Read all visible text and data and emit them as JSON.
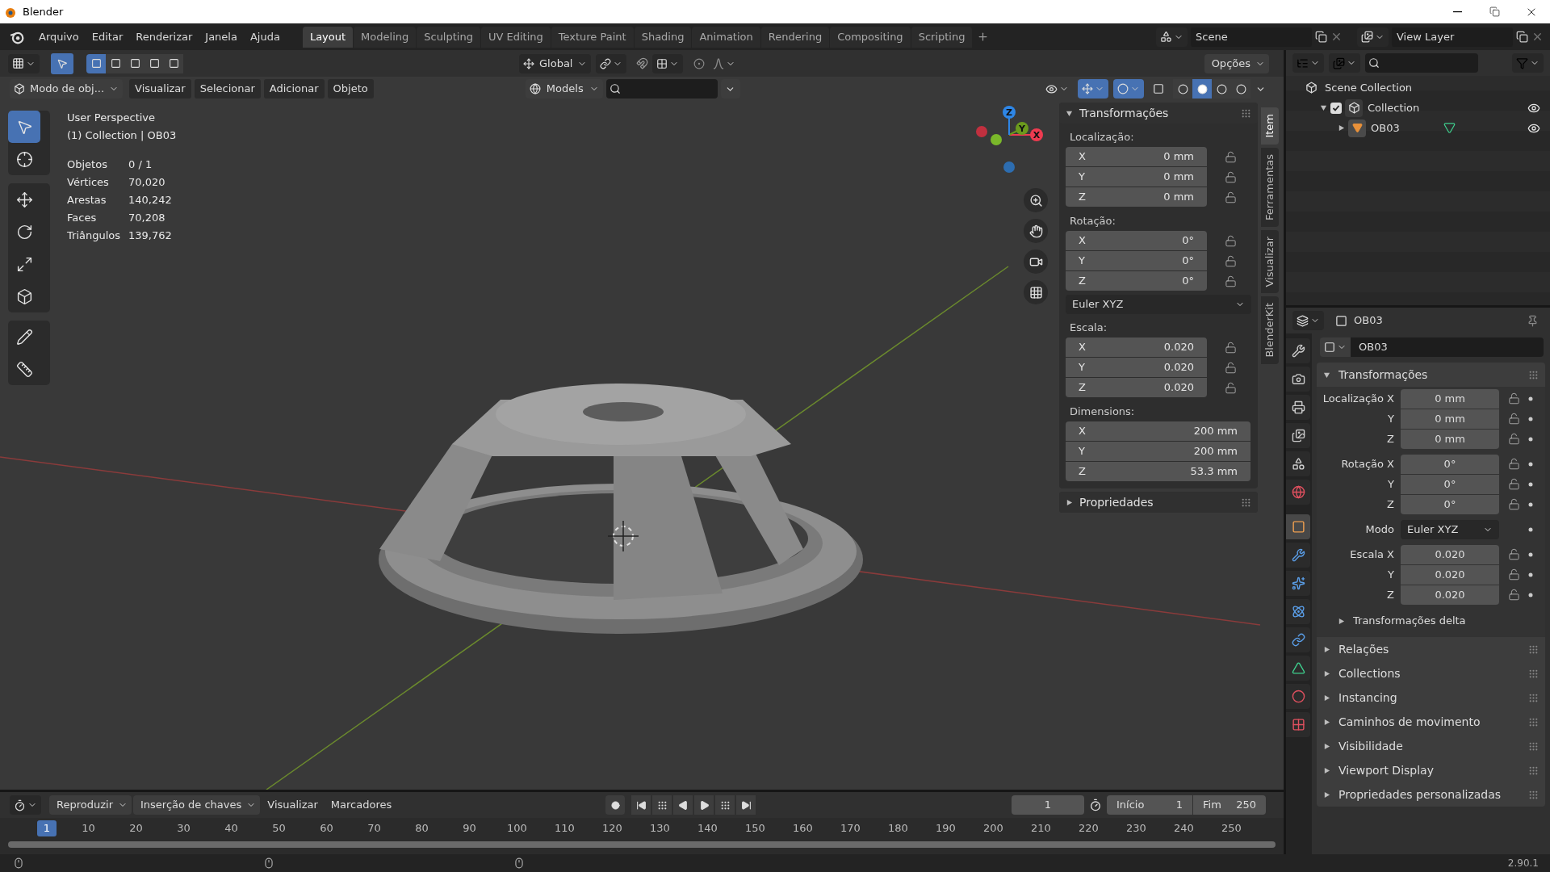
{
  "window": {
    "title": "Blender"
  },
  "menu": [
    "Arquivo",
    "Editar",
    "Renderizar",
    "Janela",
    "Ajuda"
  ],
  "workspaces": [
    {
      "label": "Layout",
      "selected": true
    },
    {
      "label": "Modeling",
      "selected": false
    },
    {
      "label": "Sculpting",
      "selected": false
    },
    {
      "label": "UV Editing",
      "selected": false
    },
    {
      "label": "Texture Paint",
      "selected": false
    },
    {
      "label": "Shading",
      "selected": false
    },
    {
      "label": "Animation",
      "selected": false
    },
    {
      "label": "Rendering",
      "selected": false
    },
    {
      "label": "Compositing",
      "selected": false
    },
    {
      "label": "Scripting",
      "selected": false
    }
  ],
  "scene": "Scene",
  "view_layer": "View Layer",
  "viewport": {
    "header": {
      "orientation": "Global",
      "options": "Opções",
      "mode": "Modo de obj...",
      "menus": [
        "Visualizar",
        "Selecionar",
        "Adicionar",
        "Objeto"
      ],
      "collection": "Models"
    },
    "tools": [
      {
        "kind": "select",
        "selected": true
      },
      {
        "kind": "cursor",
        "selected": false
      },
      {
        "kind": "move",
        "selected": false
      },
      {
        "kind": "rotate",
        "selected": false
      },
      {
        "kind": "scale",
        "selected": false
      },
      {
        "kind": "transform",
        "selected": false
      },
      {
        "kind": "annotate",
        "selected": false
      },
      {
        "kind": "measure",
        "selected": false
      }
    ],
    "view": "User Perspective",
    "context": "(1) Collection | OB03",
    "stats": [
      {
        "label": "Objetos",
        "value": "0 / 1"
      },
      {
        "label": "Vértices",
        "value": "70,020"
      },
      {
        "label": "Arestas",
        "value": "140,242"
      },
      {
        "label": "Faces",
        "value": "70,208"
      },
      {
        "label": "Triângulos",
        "value": "139,762"
      }
    ],
    "gizmo_axes": [
      "X",
      "Y",
      "Z"
    ]
  },
  "sidebar": {
    "tabs": [
      {
        "label": "Item",
        "selected": true
      },
      {
        "label": "Ferramentas",
        "selected": false
      },
      {
        "label": "Visualizar",
        "selected": false
      },
      {
        "label": "BlenderKit",
        "selected": false
      }
    ],
    "panels": [
      {
        "title": "Transformações",
        "expanded": true,
        "groups": [
          {
            "kind": "vector",
            "label": "Localização:",
            "rows": [
              {
                "axis": "X",
                "value": "0 mm",
                "locked": false
              },
              {
                "axis": "Y",
                "value": "0 mm",
                "locked": false
              },
              {
                "axis": "Z",
                "value": "0 mm",
                "locked": false
              }
            ]
          },
          {
            "kind": "vector",
            "label": "Rotação:",
            "rows": [
              {
                "axis": "X",
                "value": "0°",
                "locked": false
              },
              {
                "axis": "Y",
                "value": "0°",
                "locked": false
              },
              {
                "axis": "Z",
                "value": "0°",
                "locked": false
              }
            ]
          },
          {
            "kind": "dropdown",
            "value": "Euler XYZ"
          },
          {
            "kind": "vector",
            "label": "Escala:",
            "rows": [
              {
                "axis": "X",
                "value": "0.020",
                "locked": false
              },
              {
                "axis": "Y",
                "value": "0.020",
                "locked": false
              },
              {
                "axis": "Z",
                "value": "0.020",
                "locked": false
              }
            ]
          },
          {
            "kind": "wide",
            "label": "Dimensions:",
            "rows": [
              {
                "axis": "X",
                "value": "200 mm"
              },
              {
                "axis": "Y",
                "value": "200 mm"
              },
              {
                "axis": "Z",
                "value": "53.3 mm"
              }
            ]
          }
        ]
      },
      {
        "title": "Propriedades",
        "expanded": false
      }
    ]
  },
  "outliner": {
    "tree": [
      {
        "label": "Scene Collection",
        "kind": "scene_collection",
        "children": [
          {
            "label": "Collection",
            "kind": "collection",
            "checked": true,
            "expanded": true,
            "children": [
              {
                "label": "OB03",
                "kind": "object",
                "expanded": false
              }
            ]
          }
        ]
      }
    ]
  },
  "properties": {
    "object": "OB03",
    "name": "OB03",
    "tabs": [
      {
        "kind": "tool",
        "selected": false
      },
      {
        "kind": "render",
        "selected": false
      },
      {
        "kind": "output",
        "selected": false
      },
      {
        "kind": "view_layer",
        "selected": false
      },
      {
        "kind": "scene",
        "selected": false
      },
      {
        "kind": "world",
        "selected": false
      },
      {
        "kind": "object",
        "selected": true
      },
      {
        "kind": "modifiers",
        "selected": false
      },
      {
        "kind": "particles",
        "selected": false
      },
      {
        "kind": "physics",
        "selected": false
      },
      {
        "kind": "constraints",
        "selected": false
      },
      {
        "kind": "data",
        "selected": false
      },
      {
        "kind": "material",
        "selected": false
      },
      {
        "kind": "texture",
        "selected": false
      }
    ],
    "panels": [
      {
        "title": "Transformações",
        "expanded": true,
        "groups": [
          [
            {
              "kind": "number",
              "label": "Localização X",
              "value": "0 mm",
              "locked": false
            },
            {
              "kind": "number",
              "label": "Y",
              "value": "0 mm",
              "locked": false
            },
            {
              "kind": "number",
              "label": "Z",
              "value": "0 mm",
              "locked": false
            }
          ],
          [
            {
              "kind": "number",
              "label": "Rotação X",
              "value": "0°",
              "locked": false
            },
            {
              "kind": "number",
              "label": "Y",
              "value": "0°",
              "locked": false
            },
            {
              "kind": "number",
              "label": "Z",
              "value": "0°",
              "locked": false
            }
          ],
          [
            {
              "kind": "dropdown",
              "label": "Modo",
              "value": "Euler XYZ"
            }
          ],
          [
            {
              "kind": "number",
              "label": "Escala X",
              "value": "0.020",
              "locked": false
            },
            {
              "kind": "number",
              "label": "Y",
              "value": "0.020",
              "locked": false
            },
            {
              "kind": "number",
              "label": "Z",
              "value": "0.020",
              "locked": false
            }
          ]
        ],
        "subpanels": [
          {
            "title": "Transformações delta",
            "expanded": false
          }
        ]
      },
      {
        "title": "Relações",
        "expanded": false
      },
      {
        "title": "Collections",
        "expanded": false
      },
      {
        "title": "Instancing",
        "expanded": false
      },
      {
        "title": "Caminhos de movimento",
        "expanded": false
      },
      {
        "title": "Visibilidade",
        "expanded": false
      },
      {
        "title": "Viewport Display",
        "expanded": false
      },
      {
        "title": "Propriedades personalizadas",
        "expanded": false
      }
    ]
  },
  "timeline": {
    "menus": [
      {
        "label": "Reproduzir",
        "kind": "dropdown"
      },
      {
        "label": "Inserção de chaves",
        "kind": "dropdown"
      },
      {
        "label": "Visualizar",
        "kind": "menu"
      },
      {
        "label": "Marcadores",
        "kind": "menu"
      }
    ],
    "current_frame": "1",
    "start_label": "Início",
    "start": "1",
    "end_label": "Fim",
    "end": "250",
    "playhead": "1",
    "ticks": [
      "10",
      "20",
      "30",
      "40",
      "50",
      "60",
      "70",
      "80",
      "90",
      "100",
      "110",
      "120",
      "130",
      "140",
      "150",
      "160",
      "170",
      "180",
      "190",
      "200",
      "210",
      "220",
      "230",
      "240",
      "250"
    ]
  },
  "status": {
    "version": "2.90.1"
  }
}
